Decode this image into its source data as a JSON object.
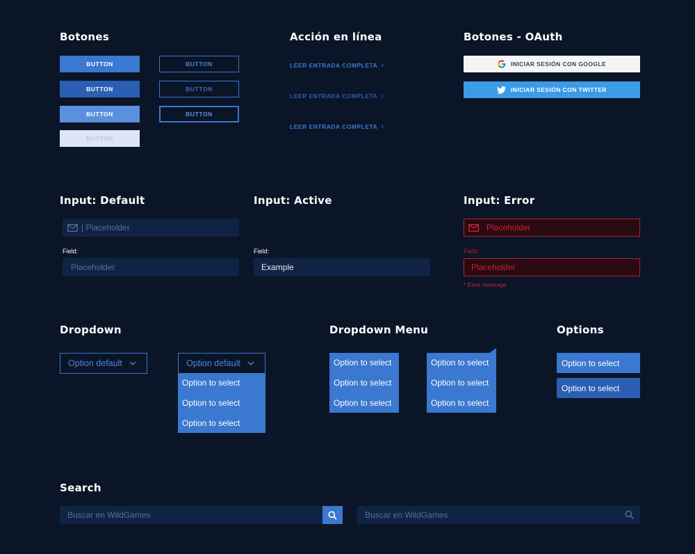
{
  "botones": {
    "title": "Botones",
    "filled": [
      "BUTTON",
      "BUTTON",
      "BUTTON",
      "BUTTON"
    ],
    "outlined": [
      "BUTTON",
      "BUTTON",
      "BUTTON"
    ]
  },
  "accion": {
    "title": "Acción en línea",
    "links": [
      "LEER ENTRADA COMPLETA",
      "LEER ENTRADA COMPLETA",
      "LEER ENTRADA COMPLETA"
    ]
  },
  "oauth": {
    "title": "Botones - OAuth",
    "google": "INICIAR SESIÓN CON GOOGLE",
    "twitter": "INICIAR SESIÓN CON TWITTER"
  },
  "input_default": {
    "title": "Input: Default",
    "placeholder_icon": "| Placeholder",
    "field_label": "Field:",
    "placeholder": "Placeholder"
  },
  "input_active": {
    "title": "Input: Active",
    "field_label": "Field:",
    "value": "Example"
  },
  "input_error": {
    "title": "Input: Error",
    "placeholder_icon": "Placeholder",
    "field_label": "Field:",
    "placeholder": "Placeholder",
    "error_message": "* Error message"
  },
  "dropdown": {
    "title": "Dropdown",
    "closed_value": "Option default",
    "open_value": "Option default",
    "options": [
      "Option to select",
      "Option to select",
      "Option to select"
    ]
  },
  "dropdown_menu": {
    "title": "Dropdown Menu",
    "menu1": [
      "Option to select",
      "Option to select",
      "Option to select"
    ],
    "menu2": [
      "Option to select",
      "Option to select",
      "Option to select"
    ]
  },
  "options": {
    "title": "Options",
    "items": [
      "Option to select",
      "Option to select"
    ]
  },
  "search": {
    "title": "Search",
    "placeholder1": "Buscar en WildGames",
    "placeholder2": "Buscar en WildGames"
  },
  "colors": {
    "background": "#0b1528",
    "accent": "#3b78cf",
    "error": "#b3202e",
    "twitter": "#3c9be8"
  },
  "icons": [
    "mail-icon",
    "chevron-right-icon",
    "chevron-down-icon",
    "google-icon",
    "twitter-icon",
    "search-icon"
  ]
}
